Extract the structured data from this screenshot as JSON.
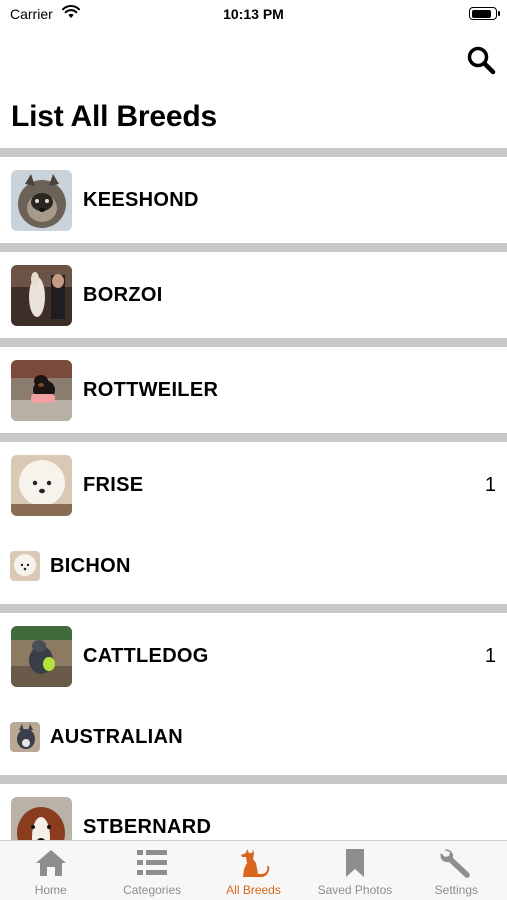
{
  "status_bar": {
    "carrier": "Carrier",
    "time": "10:13 PM",
    "battery_level": 0.9
  },
  "header": {
    "title": "List All Breeds",
    "search_icon": "search-icon"
  },
  "breeds": [
    {
      "name": "KEESHOND",
      "count": "",
      "sub_breeds": []
    },
    {
      "name": "BORZOI",
      "count": "",
      "sub_breeds": []
    },
    {
      "name": "ROTTWEILER",
      "count": "",
      "sub_breeds": []
    },
    {
      "name": "FRISE",
      "count": "1",
      "sub_breeds": [
        {
          "name": "BICHON"
        }
      ]
    },
    {
      "name": "CATTLEDOG",
      "count": "1",
      "sub_breeds": [
        {
          "name": "AUSTRALIAN"
        }
      ]
    },
    {
      "name": "STBERNARD",
      "count": "",
      "sub_breeds": []
    }
  ],
  "tab_bar": {
    "active_color": "#d9661e",
    "inactive_color": "#8e8e8e",
    "tabs": [
      {
        "label": "Home",
        "icon": "home-icon"
      },
      {
        "label": "Categories",
        "icon": "list-icon"
      },
      {
        "label": "All Breeds",
        "icon": "dog-icon",
        "active": true
      },
      {
        "label": "Saved Photos",
        "icon": "bookmark-icon"
      },
      {
        "label": "Settings",
        "icon": "wrench-icon"
      }
    ]
  }
}
